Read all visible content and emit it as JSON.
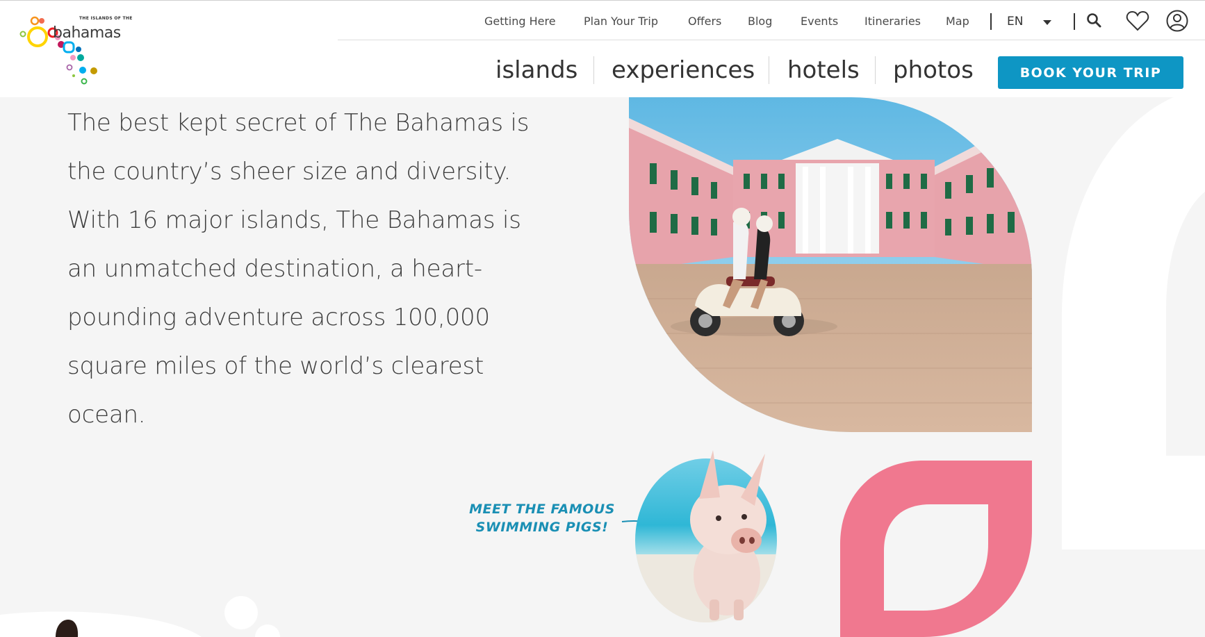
{
  "logo": {
    "small_text": "THE ISLANDS OF THE",
    "text": "bahamas"
  },
  "utility_nav": {
    "links": [
      "Getting Here",
      "Plan Your Trip",
      "Offers",
      "Blog",
      "Events",
      "Itineraries",
      "Map"
    ],
    "language": "EN",
    "icons": [
      "search-icon",
      "heart-icon",
      "user-icon"
    ]
  },
  "main_nav": {
    "items": [
      "islands",
      "experiences",
      "hotels",
      "photos"
    ],
    "cta": "BOOK YOUR TRIP"
  },
  "intro": {
    "lines": [
      "The best kept secret of The Bahamas is",
      "the country’s sheer size and diversity.",
      "With 16 major islands, The Bahamas is",
      "an unmatched destination, a heart-",
      "pounding adventure across 100,000",
      "square miles of the world’s clearest",
      "ocean."
    ]
  },
  "callout": {
    "line1": "MEET THE FAMOUS",
    "line2": "SWIMMING PIGS!"
  },
  "colors": {
    "accent_blue": "#0e96c4",
    "callout_blue": "#1a8fb4",
    "pink": "#f0788f",
    "background": "#f5f5f5"
  }
}
